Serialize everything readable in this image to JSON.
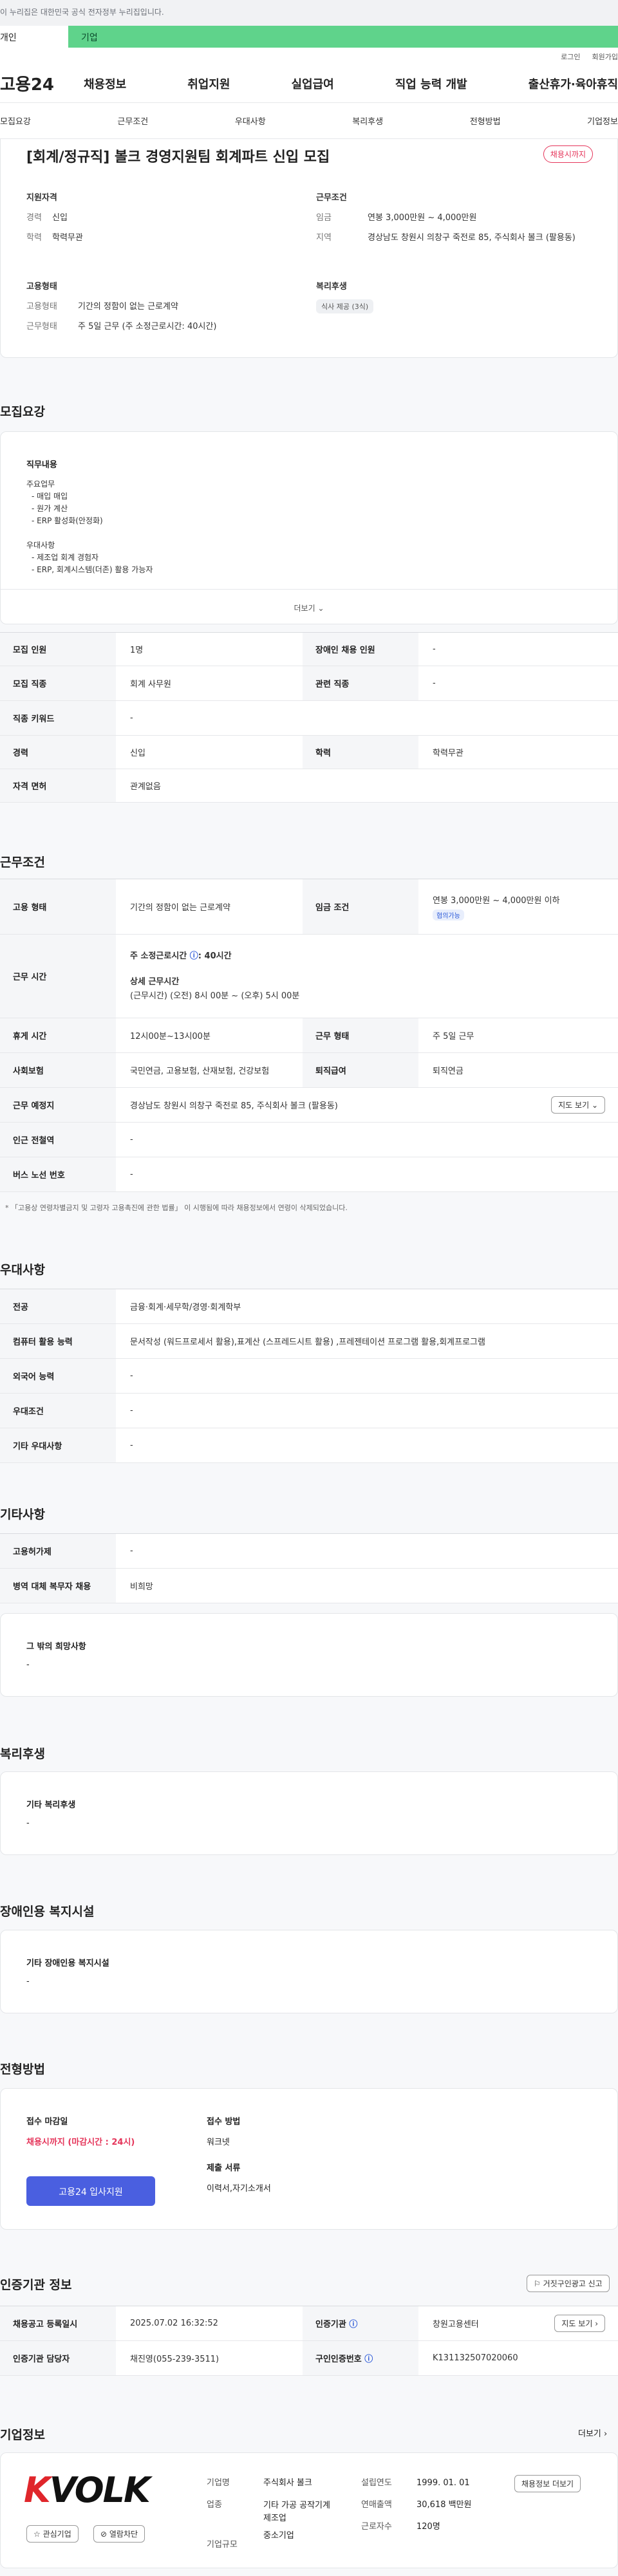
{
  "gov_banner": "이 누리집은 대한민국 공식 전자정부 누리집입니다.",
  "top_tabs": [
    "개인",
    "기업"
  ],
  "util": [
    "로그인",
    "회원가입"
  ],
  "logo": "고용24",
  "gnb": [
    "채용정보",
    "취업지원",
    "실업급여",
    "직업 능력 개발",
    "출산휴가·육아휴직"
  ],
  "subnav": [
    "모집요강",
    "근무조건",
    "우대사항",
    "복리후생",
    "전형방법",
    "기업정보"
  ],
  "summary": {
    "title": "[회계/정규직] 볼크 경영지원팀 회계파트 신입 모집",
    "badge": "채용시까지",
    "qual_title": "지원자격",
    "qual": [
      [
        "경력",
        "신입"
      ],
      [
        "학력",
        "학력무관"
      ]
    ],
    "cond_title": "근무조건",
    "cond": [
      [
        "임금",
        "연봉 3,000만원 ~ 4,000만원"
      ],
      [
        "지역",
        "경상남도 창원시 의창구 죽전로 85, 주식회사 볼크 (팔용동)"
      ]
    ],
    "emp_title": "고용형태",
    "emp": [
      [
        "고용형태",
        "기간의 정함이 없는 근로계약"
      ],
      [
        "근무형태",
        "주 5일 근무 (주 소정근로시간: 40시간)"
      ]
    ],
    "welfare_title": "복리후생",
    "welfare_pill": "식사 제공 (3식)"
  },
  "recruit": {
    "title": "모집요강",
    "duty_title": "직무내용",
    "duty_lines": [
      "주요업무",
      "- 매입 매입",
      "- 원가 계산",
      "- ERP 활성화(안정화)",
      "",
      "우대사항",
      "- 제조업 회계 경험자",
      "- ERP, 회계시스템(더존) 활용 가능자"
    ],
    "more": "더보기",
    "rows": [
      [
        "모집 인원",
        "1명",
        "장애인 채용 인원",
        "-"
      ],
      [
        "모집 직종",
        "회계 사무원",
        "관련 직종",
        "-"
      ],
      [
        "직종 키워드",
        "-"
      ],
      [
        "경력",
        "신입",
        "학력",
        "학력무관"
      ],
      [
        "자격 면허",
        "관계없음"
      ]
    ]
  },
  "work": {
    "title": "근무조건",
    "type_th": "고용 형태",
    "type_td": "기간의 정함이 없는 근로계약",
    "wage_th": "임금 조건",
    "wage_td": "연봉 3,000만원 ~ 4,000만원 이하",
    "wage_badge": "협의가능",
    "hours_th": "근무 시간",
    "hours_1": "주 소정근로시간",
    "hours_1b": ": 40시간",
    "hours_2": "상세 근무시간",
    "hours_3": "(근무시간) (오전) 8시 00분 ~ (오후) 5시 00분",
    "rows": [
      [
        "휴게 시간",
        "12시00분~13시00분",
        "근무 형태",
        "주 5일 근무"
      ],
      [
        "사회보험",
        "국민연금, 고용보험, 산재보험, 건강보험",
        "퇴직급여",
        "퇴직연금"
      ]
    ],
    "place_th": "근무 예정지",
    "place_td": "경상남도 창원시 의창구 죽전로 85, 주식회사 볼크 (팔용동)",
    "map_btn": "지도 보기",
    "rows2": [
      [
        "인근 전철역",
        "-"
      ],
      [
        "버스 노선 번호",
        "-"
      ]
    ],
    "note": "* 「고용상 연령차별금지 및 고령자 고용촉진에 관한 법률」 이 시행됨에 따라 채용정보에서 연령이 삭제되었습니다."
  },
  "pref": {
    "title": "우대사항",
    "rows": [
      [
        "전공",
        "금융·회계·세무학/경영·회계학부"
      ],
      [
        "컴퓨터 활용 능력",
        "문서작성 (워드프로세서 활용),표계산 (스프레드시트 활용) ,프레젠테이션 프로그램 활용,회계프로그램"
      ],
      [
        "외국어 능력",
        "-"
      ],
      [
        "우대조건",
        "-"
      ],
      [
        "기타 우대사항",
        "-"
      ]
    ]
  },
  "etc": {
    "title": "기타사항",
    "rows": [
      [
        "고용허가제",
        "-"
      ],
      [
        "병역 대체 복무자 채용",
        "비희망"
      ]
    ],
    "wish_title": "그 밖의 희망사항",
    "wish": "-"
  },
  "welfare": {
    "title": "복리후생",
    "sub": "기타 복리후생",
    "val": "-"
  },
  "disab": {
    "title": "장애인용 복지시설",
    "sub": "기타 장애인용 복지시설",
    "val": "-"
  },
  "screen": {
    "title": "전형방법",
    "deadline_lbl": "접수 마감일",
    "deadline": "채용시까지 (마감시간 : 24시)",
    "method_lbl": "접수 방법",
    "method": "워크넷",
    "docs_lbl": "제출 서류",
    "docs": "이력서,자기소개서",
    "apply": "고용24 입사지원"
  },
  "cert": {
    "title": "인증기관 정보",
    "report": "거짓구인광고 신고",
    "rows": [
      [
        "채용공고 등록일시",
        "2025.07.02 16:32:52",
        "인증기관",
        "창원고용센터"
      ],
      [
        "인증기관 담당자",
        "채진영(055-239-3511)",
        "구인인증번호",
        "K131132507020060"
      ]
    ],
    "map_btn": "지도 보기"
  },
  "company": {
    "title": "기업정보",
    "more": "더보기",
    "logo_text": "VOLK",
    "fav": "관심기업",
    "block": "열람차단",
    "rows": [
      [
        "기업명",
        "주식회사 볼크",
        "설립연도",
        "1999. 01. 01"
      ],
      [
        "업종",
        "기타 가공 공작기계 제조업",
        "연매출액",
        "30,618 백만원"
      ],
      [
        "기업규모",
        "중소기업",
        "근로자수",
        "120명"
      ]
    ],
    "info_btn": "채용정보 더보기"
  },
  "colors": {
    "accent": "#5fd38b",
    "brand_blue": "#4a5fe0",
    "alert": "#e5355a"
  }
}
